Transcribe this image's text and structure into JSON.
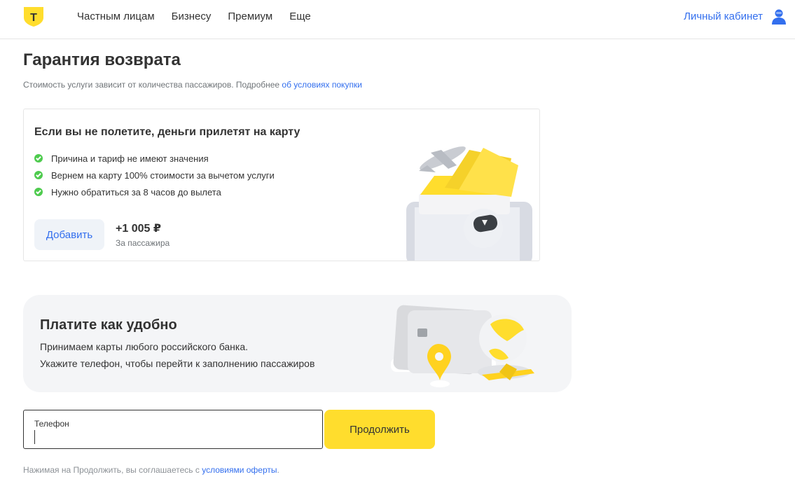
{
  "header": {
    "nav": [
      "Частным лицам",
      "Бизнесу",
      "Премиум",
      "Еще"
    ],
    "cabinet_label": "Личный кабинет",
    "logo_letter": "Т"
  },
  "page": {
    "title": "Гарантия возврата",
    "subtitle_text": "Стоимость услуги зависит от количества пассажиров. Подробнее ",
    "subtitle_link": "об условиях покупки"
  },
  "refund_card": {
    "title": "Если вы не полетите, деньги прилетят на карту",
    "features": [
      "Причина и тариф не имеют значения",
      "Вернем на карту 100% стоимости за вычетом услуги",
      "Нужно обратиться за 8 часов до вылета"
    ],
    "add_button": "Добавить",
    "price": "+1 005 ₽",
    "price_note": "За пассажира"
  },
  "payment_banner": {
    "title": "Платите как удобно",
    "line1": "Принимаем карты любого российского банка.",
    "line2": "Укажите телефон, чтобы перейти к заполнению пассажиров"
  },
  "phone_form": {
    "label": "Телефон",
    "value": "",
    "continue_button": "Продолжить"
  },
  "disclaimer": {
    "text": "Нажимая на Продолжить, вы соглашаетесь с ",
    "link": "условиями оферты",
    "end": "."
  },
  "colors": {
    "brand_yellow": "#ffdd2d",
    "link_blue": "#336fee",
    "check_green": "#4ecb4e"
  }
}
